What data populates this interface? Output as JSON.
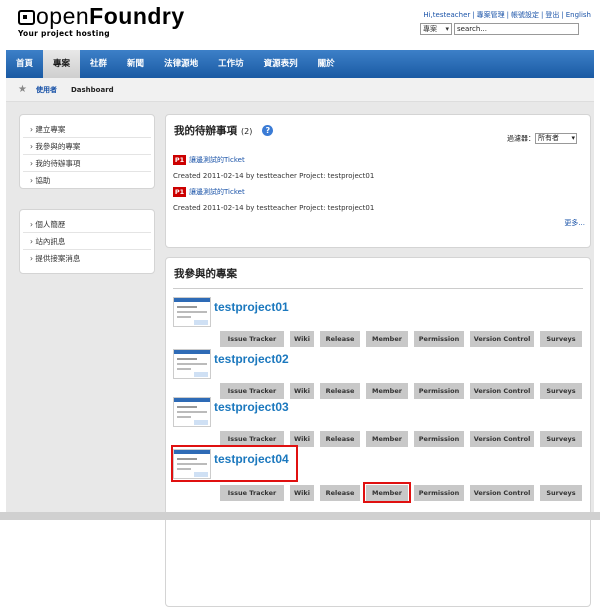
{
  "logo": {
    "open": "open",
    "foundry": "Foundry",
    "tagline": "Your project hosting"
  },
  "topnav": {
    "user": "Hi,testeacher",
    "items": [
      "專案管理",
      "帳號設定",
      "登出",
      "English"
    ]
  },
  "search": {
    "scope": "專案",
    "value": "search..."
  },
  "mainnav": [
    "首頁",
    "專案",
    "社群",
    "新聞",
    "法律源地",
    "工作坊",
    "資源表列",
    "關於"
  ],
  "breadcrumb": {
    "user": "使用者",
    "current": "Dashboard"
  },
  "sidebar1": [
    "建立專案",
    "我參與的專案",
    "我的待辦事項",
    "協助"
  ],
  "sidebar2": [
    "個人簡歷",
    "站內訊息",
    "提供接案消息"
  ],
  "todo": {
    "title": "我的待辦事項",
    "count": "(2)",
    "filter_label": "過濾器：",
    "filter_value": "所有者",
    "tickets": [
      {
        "priority": "P1",
        "title": "讓邊測試的Ticket",
        "meta": "Created 2011-02-14   by testteacher   Project:   testproject01"
      },
      {
        "priority": "P1",
        "title": "讓邊測試的Ticket",
        "meta": "Created 2011-02-14   by testteacher   Project:   testproject01"
      }
    ],
    "more": "更多..."
  },
  "projects": {
    "title": "我參與的專案",
    "buttons": [
      "Issue Tracker",
      "Wiki",
      "Release",
      "Member",
      "Permission",
      "Version Control",
      "Surveys"
    ],
    "items": [
      "testproject01",
      "testproject02",
      "testproject03",
      "testproject04"
    ]
  },
  "colors": {
    "nav_blue": "#1f5fa8",
    "link_blue": "#1a53a8",
    "project_blue": "#1b78be",
    "highlight_red": "#e01010",
    "priority_red": "#cc0000"
  }
}
